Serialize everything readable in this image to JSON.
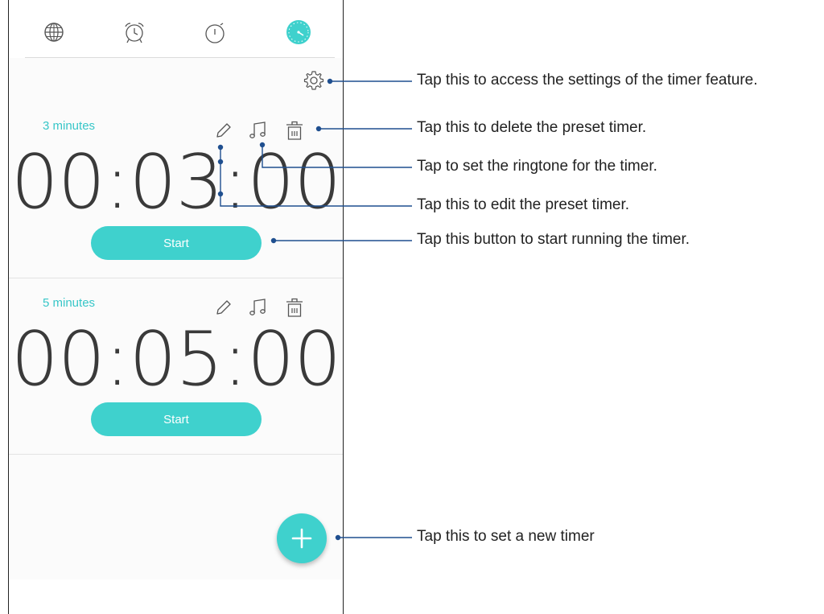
{
  "tabs": [
    {
      "name": "world-clock",
      "icon": "globe-icon"
    },
    {
      "name": "alarm",
      "icon": "alarm-clock-icon"
    },
    {
      "name": "stopwatch",
      "icon": "stopwatch-icon"
    },
    {
      "name": "timer",
      "icon": "timer-icon",
      "active": true
    }
  ],
  "timers": [
    {
      "label": "3 minutes",
      "time": "00:03:00",
      "start_label": "Start"
    },
    {
      "label": "5 minutes",
      "time": "00:05:00",
      "start_label": "Start"
    }
  ],
  "callouts": {
    "settings": "Tap this to access the settings of the timer feature.",
    "delete": "Tap this to delete the preset timer.",
    "ringtone": "Tap to set the ringtone for the timer.",
    "edit": "Tap this to edit the preset timer.",
    "start": "Tap this button to start running the timer.",
    "add": "Tap this to set a new timer"
  },
  "colors": {
    "accent": "#3fd1cd",
    "label": "#37c6c8",
    "callout_line": "#1f4f8f"
  }
}
